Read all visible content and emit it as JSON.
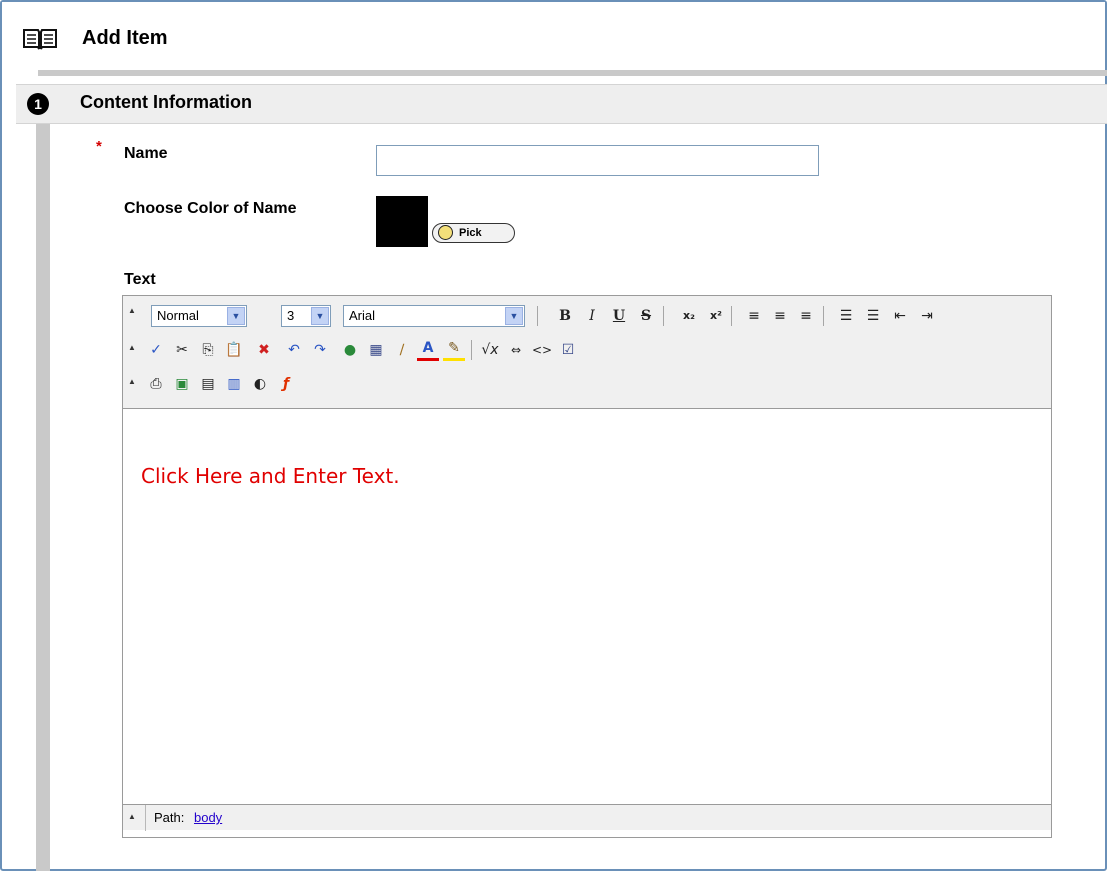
{
  "header": {
    "title": "Add Item",
    "icon": "book-icon"
  },
  "section": {
    "step": "1",
    "title": "Content Information"
  },
  "form": {
    "required_marker": "*",
    "name_label": "Name",
    "name_value": "",
    "color_label": "Choose Color of Name",
    "color_value": "#000000",
    "pick_label": "Pick",
    "text_label": "Text"
  },
  "editor": {
    "format_select": "Normal",
    "size_select": "3",
    "font_select": "Arial",
    "toolbar_row1": [
      "bold",
      "italic",
      "underline",
      "strikethrough",
      "subscript",
      "superscript",
      "align-left",
      "align-center",
      "align-right",
      "ordered-list",
      "unordered-list",
      "outdent",
      "indent"
    ],
    "toolbar_row2": [
      "spellcheck",
      "cut",
      "copy",
      "paste",
      "remove-format",
      "undo",
      "redo",
      "link",
      "table",
      "draw",
      "text-color",
      "highlight-color",
      "equation",
      "toggle-html",
      "source-code",
      "preview"
    ],
    "toolbar_row3": [
      "attach-file",
      "insert-image",
      "insert-media",
      "insert-document",
      "insert-audio",
      "insert-flash"
    ],
    "placeholder_text": "Click Here and Enter Text.",
    "path_label": "Path:",
    "path_link": "body"
  },
  "colors": {
    "frame": "#6a90b8",
    "placeholder": "#e00000",
    "link": "#2200cc"
  }
}
